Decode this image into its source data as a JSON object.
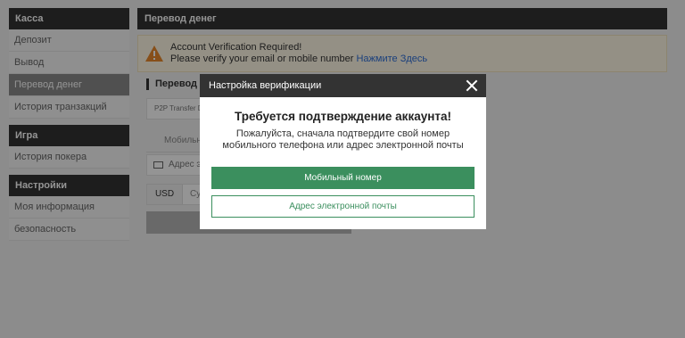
{
  "sidebar": {
    "groups": [
      {
        "title": "Касса",
        "items": [
          {
            "label": "Депозит"
          },
          {
            "label": "Вывод"
          },
          {
            "label": "Перевод денег",
            "active": true
          },
          {
            "label": "История транзакций"
          }
        ]
      },
      {
        "title": "Игра",
        "items": [
          {
            "label": "История покера"
          }
        ]
      },
      {
        "title": "Настройки",
        "items": [
          {
            "label": "Моя информация"
          },
          {
            "label": "безопасность"
          }
        ]
      }
    ]
  },
  "main": {
    "title": "Перевод денег",
    "alert": {
      "line1": "Account Verification Required!",
      "line2": "Please verify your email or mobile number",
      "link": "Нажмите Здесь"
    },
    "section_title": "Перевод с",
    "p2p_label": "P2P Transfer D",
    "tab_label": "Мобильн",
    "email_label": "Адрес эл",
    "currency": "USD",
    "sum_label": "Су"
  },
  "modal": {
    "title": "Настройка верификации",
    "heading": "Требуется подтверждение аккаунта!",
    "text": "Пожалуйста, сначала подтвердите свой номер мобильного телефона или адрес электронной почты",
    "primary_button": "Мобильный номер",
    "secondary_button": "Адрес электронной почты"
  },
  "colors": {
    "header_bg": "#333333",
    "accent_green": "#3b8f5e",
    "link_blue": "#2f6fd6",
    "warning_orange": "#e8892c"
  }
}
